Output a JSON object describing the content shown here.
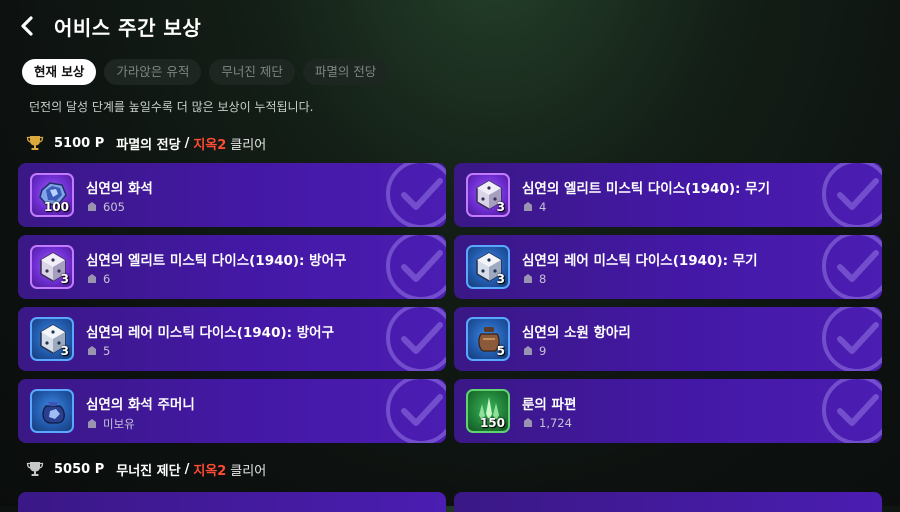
{
  "header": {
    "title": "어비스 주간 보상"
  },
  "tabs": [
    {
      "label": "현재 보상",
      "active": true
    },
    {
      "label": "가라앉은 유적",
      "active": false
    },
    {
      "label": "무너진 제단",
      "active": false
    },
    {
      "label": "파멸의 전당",
      "active": false
    }
  ],
  "description": "던전의 달성 단계를 높일수록 더 많은 보상이 누적됩니다.",
  "sections": [
    {
      "points": "5100 P",
      "dungeon": "파멸의 전당",
      "separator": "/",
      "difficulty": "지옥2",
      "clear": "클리어",
      "trophy_color": "#d9a93b",
      "rewards": [
        {
          "name": "심연의 화석",
          "qty": "100",
          "owned": "605",
          "icon": "fossil-icon",
          "frame": "purple"
        },
        {
          "name": "심연의 엘리트 미스틱 다이스(1940): 무기",
          "qty": "3",
          "owned": "4",
          "icon": "dice-icon",
          "frame": "purple"
        },
        {
          "name": "심연의 엘리트 미스틱 다이스(1940): 방어구",
          "qty": "3",
          "owned": "6",
          "icon": "dice-icon",
          "frame": "purple"
        },
        {
          "name": "심연의 레어 미스틱 다이스(1940): 무기",
          "qty": "3",
          "owned": "8",
          "icon": "dice-icon",
          "frame": "blue"
        },
        {
          "name": "심연의 레어 미스틱 다이스(1940): 방어구",
          "qty": "3",
          "owned": "5",
          "icon": "dice-icon",
          "frame": "blue"
        },
        {
          "name": "심연의 소원 항아리",
          "qty": "5",
          "owned": "9",
          "icon": "jar-icon",
          "frame": "blue"
        },
        {
          "name": "심연의 화석 주머니",
          "qty": "",
          "owned": "미보유",
          "icon": "pouch-icon",
          "frame": "blue"
        },
        {
          "name": "룬의 파편",
          "qty": "150",
          "owned": "1,724",
          "icon": "rune-shard-icon",
          "frame": "green"
        }
      ]
    },
    {
      "points": "5050 P",
      "dungeon": "무너진 제단",
      "separator": "/",
      "difficulty": "지옥2",
      "clear": "클리어",
      "trophy_color": "#c8c8c8"
    }
  ],
  "colors": {
    "card_purple": "#4418a6",
    "hell_red": "#ff4a35",
    "tab_active": "#ffffff"
  }
}
